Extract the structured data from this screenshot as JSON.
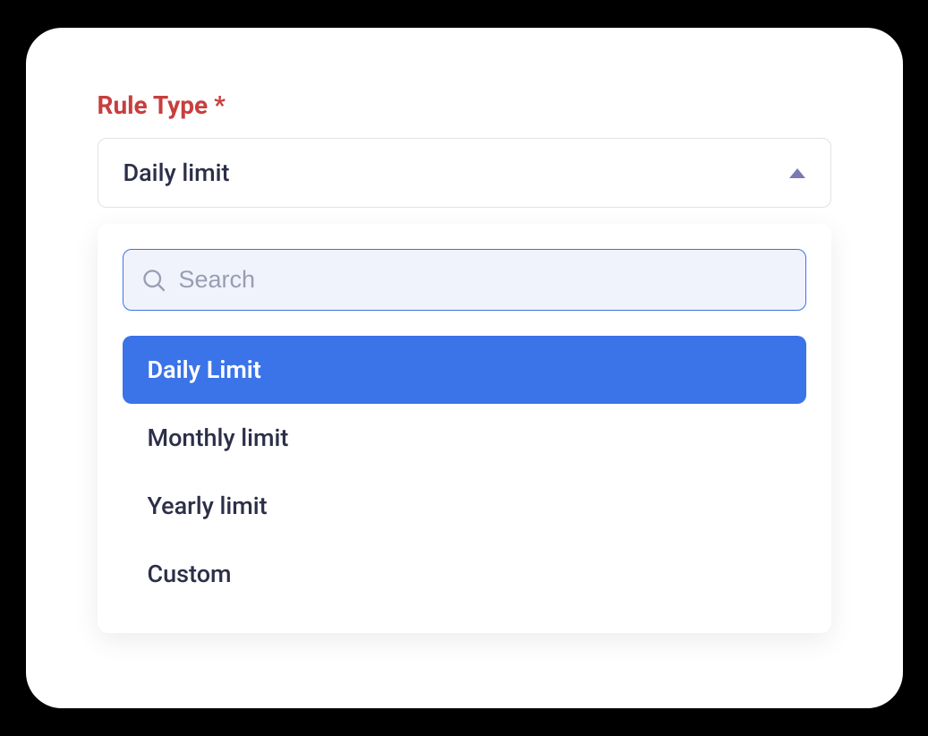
{
  "field": {
    "label": "Rule Type *",
    "selected_value": "Daily limit"
  },
  "dropdown": {
    "search_placeholder": "Search",
    "options": [
      {
        "label": "Daily Limit",
        "selected": true
      },
      {
        "label": "Monthly limit",
        "selected": false
      },
      {
        "label": "Yearly limit",
        "selected": false
      },
      {
        "label": "Custom",
        "selected": false
      }
    ]
  }
}
